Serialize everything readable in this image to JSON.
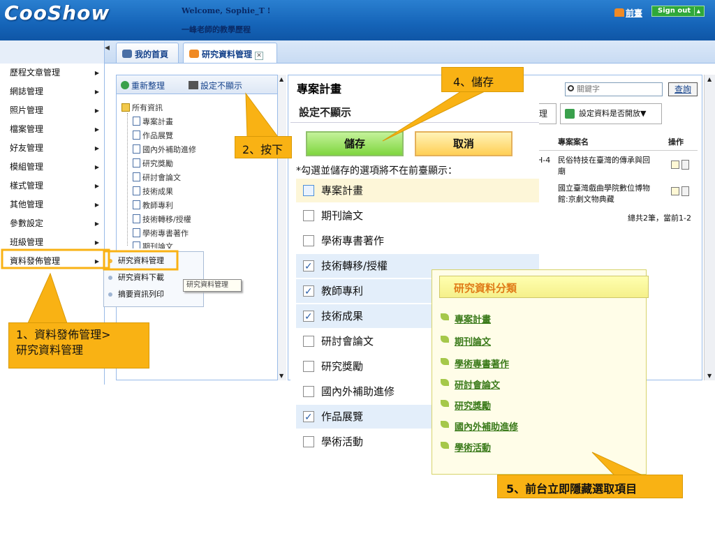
{
  "header": {
    "logo": "CooShow",
    "welcome": "Welcome, Sophie_T !",
    "blog_title": "一峰老師的教學歷程",
    "frontend_link": "前臺",
    "signout": "Sign out"
  },
  "tabs": [
    {
      "label": "我的首頁"
    },
    {
      "label": "研究資料管理"
    }
  ],
  "sidebar": {
    "items": [
      {
        "label": "歷程文章管理"
      },
      {
        "label": "網誌管理"
      },
      {
        "label": "照片管理"
      },
      {
        "label": "檔案管理"
      },
      {
        "label": "好友管理"
      },
      {
        "label": "模組管理"
      },
      {
        "label": "樣式管理"
      },
      {
        "label": "其他管理"
      },
      {
        "label": "參數設定"
      },
      {
        "label": "班級管理"
      },
      {
        "label": "資料發佈管理"
      }
    ]
  },
  "submenu": {
    "items": [
      {
        "label": "研究資料管理"
      },
      {
        "label": "研究資料下載"
      },
      {
        "label": "摘要資訊列印"
      }
    ],
    "tooltip": "研究資料管理"
  },
  "tree": {
    "refresh_label": "重新整理",
    "hide_label": "設定不顯示",
    "root": "所有資訊",
    "nodes": [
      "專案計畫",
      "作品展覽",
      "國內外補助進修",
      "研究獎勵",
      "研討會論文",
      "技術成果",
      "教師專利",
      "技術轉移/授權",
      "學術專書著作",
      "期刊論文"
    ]
  },
  "grid": {
    "title": "專案計畫",
    "search_placeholder": "關鍵字",
    "query_label": "查詢",
    "toolbar_partial": "理",
    "open_setting_label": "設定資料是否開放▼",
    "col_name": "專案案名",
    "col_op": "操作",
    "rows": [
      {
        "code": "H-4",
        "name_line1": "民俗特技在臺灣的傳承與回",
        "name_line2": "廟"
      },
      {
        "code": "",
        "name_line1": "國立臺灣戲曲學院數位博物",
        "name_line2": "館:京劇文物典藏"
      }
    ],
    "total": "總共2筆，當前1-2"
  },
  "dialog": {
    "title": "設定不顯示",
    "save_label": "儲存",
    "cancel_label": "取消",
    "hint": "*勾選並儲存的選項將不在前臺顯示：",
    "options": [
      {
        "label": "專案計畫",
        "checked": false
      },
      {
        "label": "期刊論文",
        "checked": false
      },
      {
        "label": "學術專書著作",
        "checked": false
      },
      {
        "label": "技術轉移/授權",
        "checked": true
      },
      {
        "label": "教師專利",
        "checked": true
      },
      {
        "label": "技術成果",
        "checked": true
      },
      {
        "label": "研討會論文",
        "checked": false
      },
      {
        "label": "研究獎勵",
        "checked": false
      },
      {
        "label": "國內外補助進修",
        "checked": false
      },
      {
        "label": "作品展覽",
        "checked": true
      },
      {
        "label": "學術活動",
        "checked": false
      }
    ]
  },
  "preview": {
    "title": "研究資料分類",
    "links": [
      "專案計畫",
      "期刊論文",
      "學術專書著作",
      "研討會論文",
      "研究獎勵",
      "國內外補助進修",
      "學術活動"
    ]
  },
  "callouts": {
    "step1_line1": "1、資料發佈管理>",
    "step1_line2": "研究資料管理",
    "step2": "2、按下",
    "step4": "4、儲存",
    "step5": "5、前台立即隱藏選取項目"
  },
  "colors": {
    "header_blue": "#1564b8",
    "callout_orange": "#f9b214",
    "save_green": "#7fd63f",
    "cancel_yellow": "#ffcf55",
    "preview_title_orange": "#e07b18"
  }
}
